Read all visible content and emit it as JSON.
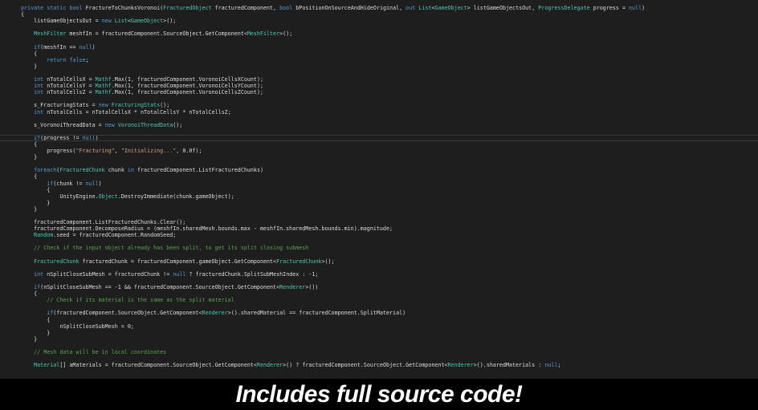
{
  "banner": {
    "text": "Includes full source code!"
  },
  "colors": {
    "background": "#1e1e1e",
    "keyword": "#569cd6",
    "type": "#4ec9b0",
    "string": "#d69d85",
    "comment": "#57a64a",
    "plain": "#dcdcdc"
  },
  "code_lines": [
    [
      [
        "kw",
        "private static bool "
      ],
      [
        "pl",
        "FractureToChunksVoronoi("
      ],
      [
        "ty",
        "FracturedObject"
      ],
      [
        "pl",
        " fracturedComponent, "
      ],
      [
        "kw",
        "bool"
      ],
      [
        "pl",
        " bPositionOnSourceAndHideOriginal, "
      ],
      [
        "kw",
        "out "
      ],
      [
        "ty",
        "List"
      ],
      [
        "pl",
        "<"
      ],
      [
        "ty",
        "GameObject"
      ],
      [
        "pl",
        "> listGameObjectsOut, "
      ],
      [
        "ty",
        "ProgressDelegate"
      ],
      [
        "pl",
        " progress = "
      ],
      [
        "kw",
        "null"
      ],
      [
        "pl",
        ")"
      ]
    ],
    [
      [
        "pl",
        "{"
      ]
    ],
    [
      [
        "pl",
        "    listGameObjectsOut = "
      ],
      [
        "kw",
        "new "
      ],
      [
        "ty",
        "List"
      ],
      [
        "pl",
        "<"
      ],
      [
        "ty",
        "GameObject"
      ],
      [
        "pl",
        ">();"
      ]
    ],
    [],
    [
      [
        "pl",
        "    "
      ],
      [
        "ty",
        "MeshFilter"
      ],
      [
        "pl",
        " meshfIn = fracturedComponent.SourceObject.GetComponent<"
      ],
      [
        "ty",
        "MeshFilter"
      ],
      [
        "pl",
        ">();"
      ]
    ],
    [],
    [
      [
        "pl",
        "    "
      ],
      [
        "kw",
        "if"
      ],
      [
        "pl",
        "(meshfIn == "
      ],
      [
        "kw",
        "null"
      ],
      [
        "pl",
        ")"
      ]
    ],
    [
      [
        "pl",
        "    {"
      ]
    ],
    [
      [
        "pl",
        "        "
      ],
      [
        "kw",
        "return false"
      ],
      [
        "pl",
        ";"
      ]
    ],
    [
      [
        "pl",
        "    }"
      ]
    ],
    [],
    [
      [
        "pl",
        "    "
      ],
      [
        "kw",
        "int"
      ],
      [
        "pl",
        " nTotalCellsX = "
      ],
      [
        "ty",
        "Mathf"
      ],
      [
        "pl",
        ".Max(1, fracturedComponent.VoronoiCellsXCount);"
      ]
    ],
    [
      [
        "pl",
        "    "
      ],
      [
        "kw",
        "int"
      ],
      [
        "pl",
        " nTotalCellsY = "
      ],
      [
        "ty",
        "Mathf"
      ],
      [
        "pl",
        ".Max(1, fracturedComponent.VoronoiCellsYCount);"
      ]
    ],
    [
      [
        "pl",
        "    "
      ],
      [
        "kw",
        "int"
      ],
      [
        "pl",
        " nTotalCellsZ = "
      ],
      [
        "ty",
        "Mathf"
      ],
      [
        "pl",
        ".Max(1, fracturedComponent.VoronoiCellsZCount);"
      ]
    ],
    [],
    [
      [
        "pl",
        "    s_FracturingStats = "
      ],
      [
        "kw",
        "new "
      ],
      [
        "ty",
        "FracturingStats"
      ],
      [
        "pl",
        "();"
      ]
    ],
    [
      [
        "pl",
        "    "
      ],
      [
        "kw",
        "int"
      ],
      [
        "pl",
        " nTotalCells = nTotalCellsX * nTotalCellsY * nTotalCellsZ;"
      ]
    ],
    [],
    [
      [
        "pl",
        "    s_VoronoiThreadData = "
      ],
      [
        "kw",
        "new "
      ],
      [
        "ty",
        "VoronoiThreadData"
      ],
      [
        "pl",
        "();"
      ]
    ],
    [],
    [
      [
        "pl",
        "    "
      ],
      [
        "kw",
        "if"
      ],
      [
        "pl",
        "(progress != "
      ],
      [
        "kw",
        "null"
      ],
      [
        "pl",
        ")"
      ]
    ],
    [
      [
        "pl",
        "    {"
      ]
    ],
    [
      [
        "pl",
        "        progress("
      ],
      [
        "st",
        "\"Fracturing\""
      ],
      [
        "pl",
        ", "
      ],
      [
        "st",
        "\"Initializing...\""
      ],
      [
        "pl",
        ", 0.0f);"
      ]
    ],
    [
      [
        "pl",
        "    }"
      ]
    ],
    [],
    [
      [
        "pl",
        "    "
      ],
      [
        "kw",
        "foreach"
      ],
      [
        "pl",
        "("
      ],
      [
        "ty",
        "FracturedChunk"
      ],
      [
        "pl",
        " chunk "
      ],
      [
        "kw",
        "in"
      ],
      [
        "pl",
        " fracturedComponent.ListFracturedChunks)"
      ]
    ],
    [
      [
        "pl",
        "    {"
      ]
    ],
    [
      [
        "pl",
        "        "
      ],
      [
        "kw",
        "if"
      ],
      [
        "pl",
        "(chunk != "
      ],
      [
        "kw",
        "null"
      ],
      [
        "pl",
        ")"
      ]
    ],
    [
      [
        "pl",
        "        {"
      ]
    ],
    [
      [
        "pl",
        "            UnityEngine."
      ],
      [
        "ty",
        "Object"
      ],
      [
        "pl",
        ".DestroyImmediate(chunk.gameObject);"
      ]
    ],
    [
      [
        "pl",
        "        }"
      ]
    ],
    [
      [
        "pl",
        "    }"
      ]
    ],
    [],
    [
      [
        "pl",
        "    fracturedComponent.ListFracturedChunks.Clear();"
      ]
    ],
    [
      [
        "pl",
        "    fracturedComponent.DecomposeRadius = (meshfIn.sharedMesh.bounds.max - meshfIn.sharedMesh.bounds.min).magnitude;"
      ]
    ],
    [
      [
        "pl",
        "    "
      ],
      [
        "ty",
        "Random"
      ],
      [
        "pl",
        ".seed = fracturedComponent.RandomSeed;"
      ]
    ],
    [],
    [
      [
        "pl",
        "    "
      ],
      [
        "cm",
        "// Check if the input object already has been split, to get its split closing submesh"
      ]
    ],
    [],
    [
      [
        "pl",
        "    "
      ],
      [
        "ty",
        "FracturedChunk"
      ],
      [
        "pl",
        " fracturedChunk = fracturedComponent.gameObject.GetComponent<"
      ],
      [
        "ty",
        "FracturedChunk"
      ],
      [
        "pl",
        ">();"
      ]
    ],
    [],
    [
      [
        "pl",
        "    "
      ],
      [
        "kw",
        "int"
      ],
      [
        "pl",
        " nSplitCloseSubMesh = fracturedChunk != "
      ],
      [
        "kw",
        "null"
      ],
      [
        "pl",
        " ? fracturedChunk.SplitSubMeshIndex : -1;"
      ]
    ],
    [],
    [
      [
        "pl",
        "    "
      ],
      [
        "kw",
        "if"
      ],
      [
        "pl",
        "(nSplitCloseSubMesh == -1 && fracturedComponent.SourceObject.GetComponent<"
      ],
      [
        "ty",
        "Renderer"
      ],
      [
        "pl",
        ">())"
      ]
    ],
    [
      [
        "pl",
        "    {"
      ]
    ],
    [
      [
        "pl",
        "        "
      ],
      [
        "cm",
        "// Check if its material is the same as the split material"
      ]
    ],
    [],
    [
      [
        "pl",
        "        "
      ],
      [
        "kw",
        "if"
      ],
      [
        "pl",
        "(fracturedComponent.SourceObject.GetComponent<"
      ],
      [
        "ty",
        "Renderer"
      ],
      [
        "pl",
        ">().sharedMaterial == fracturedComponent.SplitMaterial)"
      ]
    ],
    [
      [
        "pl",
        "        {"
      ]
    ],
    [
      [
        "pl",
        "            nSplitCloseSubMesh = 0;"
      ]
    ],
    [
      [
        "pl",
        "        }"
      ]
    ],
    [
      [
        "pl",
        "    }"
      ]
    ],
    [],
    [
      [
        "pl",
        "    "
      ],
      [
        "cm",
        "// Mesh data will be in local coordinates"
      ]
    ],
    [],
    [
      [
        "pl",
        "    "
      ],
      [
        "ty",
        "Material"
      ],
      [
        "pl",
        "[] aMaterials = fracturedComponent.SourceObject.GetComponent<"
      ],
      [
        "ty",
        "Renderer"
      ],
      [
        "pl",
        ">() ? fracturedComponent.SourceObject.GetComponent<"
      ],
      [
        "ty",
        "Renderer"
      ],
      [
        "pl",
        ">().sharedMaterials : "
      ],
      [
        "kw",
        "null"
      ],
      [
        "pl",
        ";"
      ]
    ]
  ]
}
